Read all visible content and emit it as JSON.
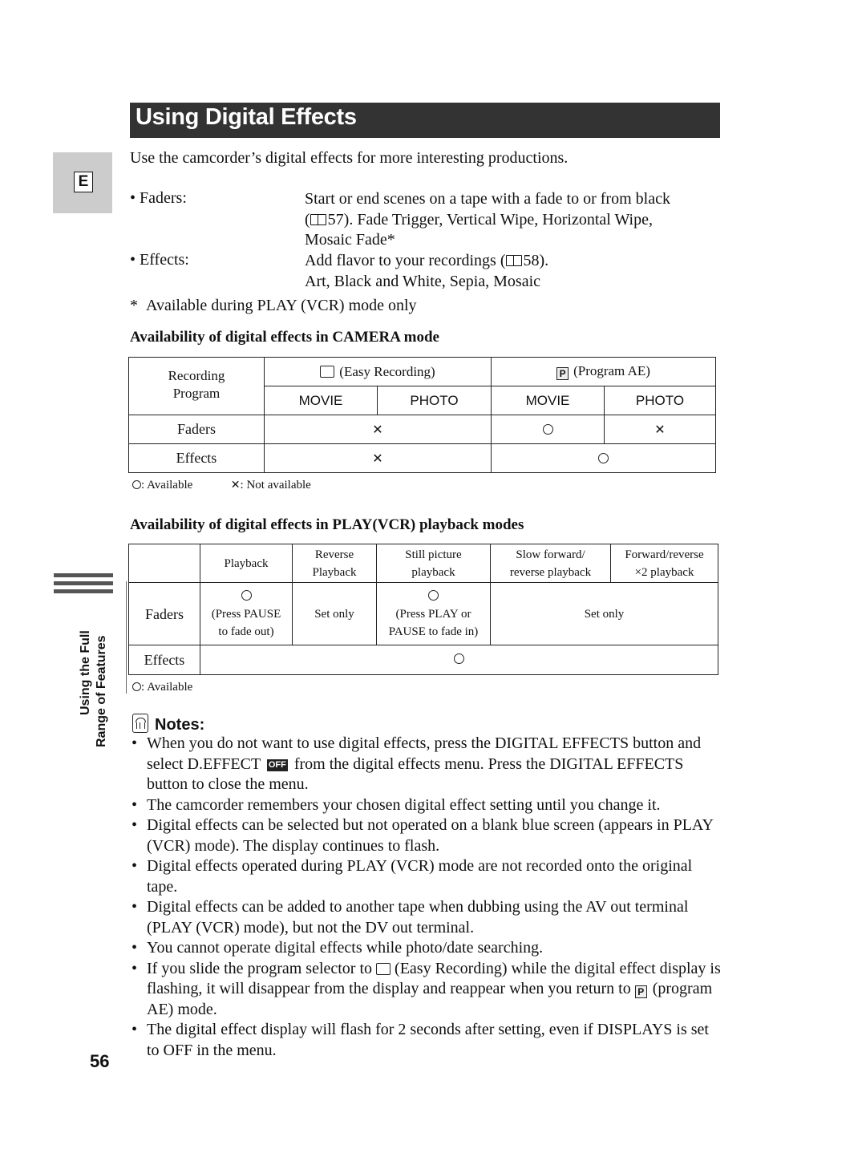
{
  "header": {
    "title": "Using Digital Effects",
    "language_tab": "E"
  },
  "intro": "Use the camcorder’s digital effects for more interesting productions.",
  "features": [
    {
      "label": "Faders:",
      "line1": "Start or end scenes on a tape with a fade to or from black",
      "line2_prefix": "(",
      "page_ref": "57",
      "line2_suffix": "). Fade Trigger, Vertical Wipe, Horizontal Wipe,",
      "line3": "Mosaic Fade*"
    },
    {
      "label": "Effects:",
      "line1_prefix": "Add flavor to your recordings (",
      "page_ref": "58",
      "line1_suffix": ").",
      "line2": "Art, Black and White, Sepia, Mosaic"
    }
  ],
  "footnote": {
    "mark": "*",
    "text": "Available during PLAY (VCR) mode only"
  },
  "camera_table": {
    "heading": "Availability of digital effects in CAMERA mode",
    "corner_label_1": "Recording",
    "corner_label_2": "Program",
    "groups": [
      {
        "icon": "easy-recording-icon",
        "label": "(Easy Recording)"
      },
      {
        "icon": "program-ae-icon",
        "icon_text": "P",
        "label": "(Program AE)"
      }
    ],
    "subcolumns": [
      "MOVIE",
      "PHOTO",
      "MOVIE",
      "PHOTO"
    ],
    "rows": [
      {
        "label": "Faders",
        "easy": "not-available",
        "program_movie": "available",
        "program_photo": "not-available"
      },
      {
        "label": "Effects",
        "easy": "not-available",
        "program": "available"
      }
    ],
    "legend": {
      "available": ": Available",
      "not_available": ": Not available"
    }
  },
  "play_table": {
    "heading": "Availability of digital effects in PLAY(VCR) playback modes",
    "columns": [
      {
        "line1": "Playback",
        "line2": ""
      },
      {
        "line1": "Reverse",
        "line2": "Playback"
      },
      {
        "line1": "Still picture",
        "line2": "playback"
      },
      {
        "line1": "Slow forward/",
        "line2": "reverse playback"
      },
      {
        "line1": "Forward/reverse",
        "line2": "×2 playback"
      }
    ],
    "rows": {
      "faders": {
        "label": "Faders",
        "playback_note1": "(Press PAUSE",
        "playback_note2": "to fade out)",
        "reverse": "Set only",
        "still_note1": "(Press PLAY or",
        "still_note2": "PAUSE to fade in)",
        "slow_and_x2": "Set only"
      },
      "effects": {
        "label": "Effects",
        "value": "available"
      }
    },
    "legend": {
      "available": ": Available"
    }
  },
  "sidebar": {
    "section_line1": "Using the Full",
    "section_line2": "Range of Features"
  },
  "notes": {
    "title": "Notes:",
    "items": [
      {
        "before": "When you do not want to use digital effects, press the DIGITAL EFFECTS button and select D.EFFECT",
        "icon_text": "OFF",
        "after": " from the digital effects menu. Press the DIGITAL EFFECTS button to close the menu."
      },
      {
        "text": "The camcorder remembers your chosen digital effect setting until you change it."
      },
      {
        "text": "Digital effects can be selected but not operated on a blank blue screen (appears in PLAY (VCR) mode). The display continues to flash."
      },
      {
        "text": "Digital effects operated during PLAY (VCR) mode are not recorded onto the original tape."
      },
      {
        "text": "Digital effects can be added to another tape when dubbing using the AV out terminal (PLAY (VCR) mode), but not the DV out terminal."
      },
      {
        "text": "You cannot operate digital effects while photo/date searching."
      },
      {
        "before": "If you slide the program selector to",
        "middle": " (Easy Recording) while the digital effect display is flashing, it will disappear from the display and reappear when you return to ",
        "icon_text": "P",
        "after": " (program AE) mode."
      },
      {
        "text": "The digital effect display will flash for 2 seconds after setting, even if DISPLAYS is set to OFF in the menu."
      }
    ]
  },
  "page_number": "56"
}
